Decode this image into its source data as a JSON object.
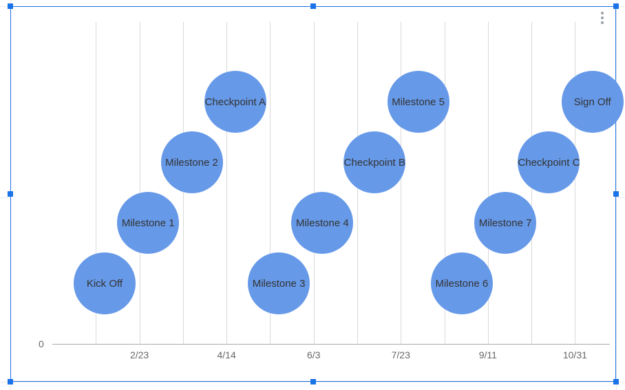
{
  "chart_data": {
    "type": "scatter",
    "x_axis_type": "date",
    "x_range_days": [
      0,
      320
    ],
    "y_range": [
      0,
      5
    ],
    "bubble_color": "#6699e8",
    "bubble_radius_px": 45,
    "grid": {
      "x": true,
      "y": false
    },
    "x_tick_labels": [
      "2/23",
      "4/14",
      "6/3",
      "7/23",
      "9/11",
      "10/31"
    ],
    "x_tick_days": [
      50,
      100,
      150,
      200,
      250,
      300
    ],
    "x_gridline_days": [
      25,
      50,
      75,
      100,
      125,
      150,
      175,
      200,
      225,
      250,
      275,
      300
    ],
    "y_zero_label": "0",
    "series": [
      {
        "name": "events",
        "points": [
          {
            "label": "Kick Off",
            "x_day": 30,
            "y": 1
          },
          {
            "label": "Milestone 1",
            "x_day": 55,
            "y": 2
          },
          {
            "label": "Milestone 2",
            "x_day": 80,
            "y": 3
          },
          {
            "label": "Checkpoint A",
            "x_day": 105,
            "y": 4
          },
          {
            "label": "Milestone 3",
            "x_day": 130,
            "y": 1
          },
          {
            "label": "Milestone 4",
            "x_day": 155,
            "y": 2
          },
          {
            "label": "Checkpoint B",
            "x_day": 185,
            "y": 3
          },
          {
            "label": "Milestone 5",
            "x_day": 210,
            "y": 4
          },
          {
            "label": "Milestone 6",
            "x_day": 235,
            "y": 1
          },
          {
            "label": "Milestone 7",
            "x_day": 260,
            "y": 2
          },
          {
            "label": "Checkpoint C",
            "x_day": 285,
            "y": 3
          },
          {
            "label": "Sign Off",
            "x_day": 310,
            "y": 4
          }
        ]
      }
    ]
  }
}
